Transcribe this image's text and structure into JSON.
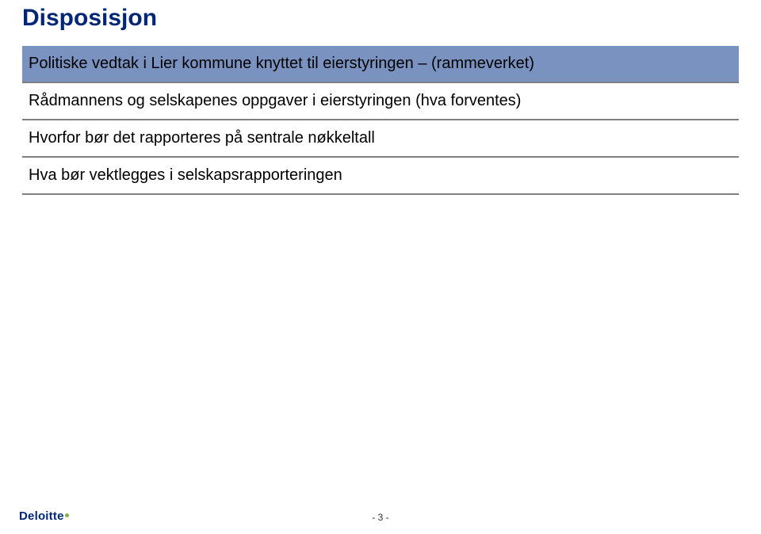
{
  "slide": {
    "title": "Disposisjon",
    "rows": [
      {
        "text": "Politiske vedtak i Lier kommune knyttet til eierstyringen – (rammeverket)",
        "highlight": true
      },
      {
        "text": "Rådmannens og selskapenes oppgaver i eierstyringen (hva forventes)",
        "highlight": false
      },
      {
        "text": "Hvorfor bør det rapporteres på sentrale nøkkeltall",
        "highlight": false
      },
      {
        "text": "Hva bør vektlegges i selskapsrapporteringen",
        "highlight": false
      }
    ]
  },
  "footer": {
    "logo": "Deloitte",
    "page_label": "- 3 -"
  }
}
